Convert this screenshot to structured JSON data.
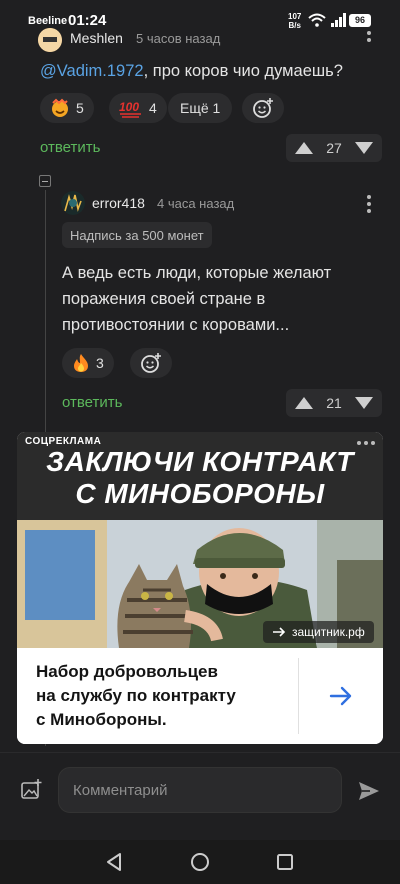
{
  "status_bar": {
    "carrier": "Beeline",
    "time": "01:24",
    "speed_value": "107",
    "speed_unit": "B/s",
    "battery": "96"
  },
  "comment_top": {
    "username": "Meshlen",
    "time_ago": "5 часов назад",
    "mention": "@Vadim.1972",
    "text": ", про коров чио думаешь?",
    "reactions": [
      {
        "icon": "smiling-face-icon",
        "count": "5"
      },
      {
        "icon": "hundred-points-icon",
        "count": "4"
      }
    ],
    "more_label": "Ещё 1",
    "reply_label": "ответить",
    "rating": "27"
  },
  "comment_reply": {
    "username": "error418",
    "time_ago": "4 часа назад",
    "badge": "Надпись за 500 монет",
    "text_lines": [
      "А ведь есть люди, которые желают",
      "поражения своей стране в",
      "противостоянии с коровами..."
    ],
    "reactions": [
      {
        "icon": "fire-icon",
        "count": "3"
      }
    ],
    "reply_label": "ответить",
    "rating": "21"
  },
  "ad": {
    "label": "СОЦРЕКЛАМА",
    "headline_line1": "ЗАКЛЮЧИ КОНТРАКТ",
    "headline_line2": "С МИНОБОРОНЫ",
    "domain": "защитник.рф",
    "description_lines": [
      "Набор добровольцев",
      "на службу по контракту",
      "с Минобороны."
    ],
    "accent_color": "#2f6fe0"
  },
  "composer": {
    "placeholder": "Комментарий"
  }
}
